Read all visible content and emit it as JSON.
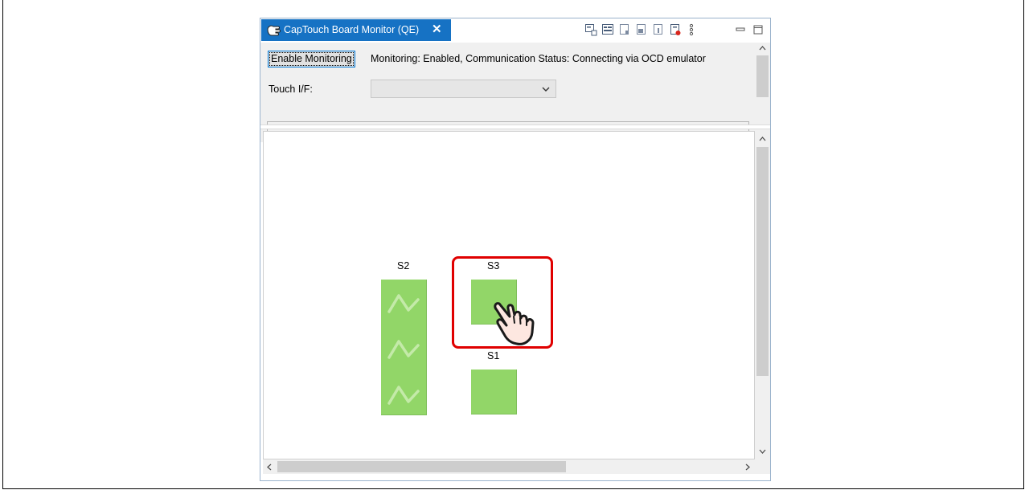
{
  "tab": {
    "title": "CapTouch Board Monitor (QE)",
    "close_glyph": "✕",
    "icon": "captouch-hand-icon"
  },
  "toolbar": {
    "icons": [
      "monitor-select-icon",
      "monitor-view-icon",
      "monitor-a-icon",
      "monitor-b-icon",
      "monitor-c-icon",
      "record-icon",
      "more-vertical-icon",
      "minimize-icon",
      "maximize-icon"
    ]
  },
  "controls": {
    "enable_button": "Enable Monitoring",
    "status": "Monitoring: Enabled, Communication Status: Connecting via OCD emulator",
    "touch_if_label": "Touch I/F:",
    "touch_if_value": ""
  },
  "sensors": {
    "s2": {
      "label": "S2",
      "type": "slider"
    },
    "s3": {
      "label": "S3",
      "type": "button",
      "touched": true
    },
    "s1": {
      "label": "S1",
      "type": "button"
    }
  },
  "colors": {
    "tab_bg": "#1672c4",
    "sensor_green": "#92d668",
    "highlight_red": "#e00000"
  }
}
